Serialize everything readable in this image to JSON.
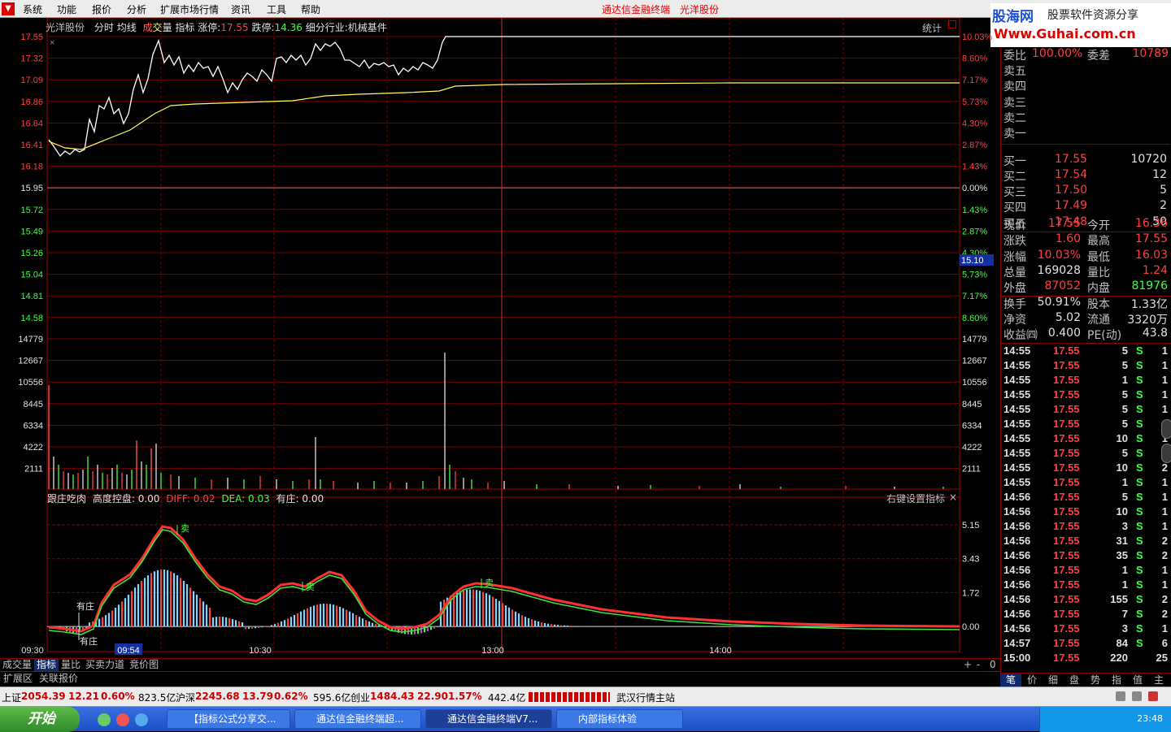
{
  "menu": {
    "items": [
      "系统",
      "功能",
      "报价",
      "分析",
      "扩展市场行情",
      "资讯",
      "工具",
      "帮助"
    ],
    "app_title": "通达信金融终端",
    "stock_title": "光洋股份"
  },
  "brand": {
    "name": "股海网",
    "tagline": "股票软件资源分享",
    "url": "Www.Guhai.com.cn"
  },
  "chart_info": {
    "stock": "光洋股份",
    "tab_fenshi": "分时",
    "tab_junxian": "均线",
    "vol_label1": "成",
    "vol_label2": "交",
    "vol_label3": "量",
    "indicator": "指标",
    "zhangting_label": "涨停:",
    "zhangting": "17.55",
    "dieting_label": "跌停:",
    "dieting": "14.36",
    "industry": "细分行业:机械基件",
    "tongji": "统计"
  },
  "price_axis": {
    "left": [
      "17.55",
      "17.32",
      "17.09",
      "16.86",
      "16.64",
      "16.41",
      "16.18",
      "15.95",
      "15.72",
      "15.49",
      "15.26",
      "15.04",
      "14.81",
      "14.58"
    ],
    "right": [
      "10.03%",
      "8.60%",
      "7.17%",
      "5.73%",
      "4.30%",
      "2.87%",
      "1.43%",
      "0.00%",
      "1.43%",
      "2.87%",
      "4.30%",
      "5.73%",
      "7.17%",
      "8.60%"
    ],
    "cursor_label": "15.10"
  },
  "volume_axis": [
    "14779",
    "12667",
    "10556",
    "8445",
    "6334",
    "4222",
    "2111"
  ],
  "sub_info": {
    "name": "跟庄吃肉",
    "kz": "高度控盘: 0.00",
    "diff": "DIFF: 0.02",
    "dea": "DEA: 0.03",
    "yz": "有庄: 0.00",
    "right_click": "右键设置指标"
  },
  "sub_axis": [
    "5.15",
    "3.43",
    "1.72",
    "0.00"
  ],
  "annotations": {
    "sell": "卖",
    "youzhuang": "有庄"
  },
  "time_axis": [
    "09:30",
    "09:54",
    "10:30",
    "13:00",
    "14:00"
  ],
  "bottom_tabs": [
    "成交量",
    "指标",
    "量比",
    "买卖力道",
    "竞价图"
  ],
  "bottom_tabs_selected": 1,
  "bottom_tabs_right": [
    "+",
    "-",
    "0"
  ],
  "row_tabs": [
    "扩展区",
    "关联报价"
  ],
  "quote": {
    "weibi_label": "委比",
    "weibi": "100.00%",
    "weicha_label": "委差",
    "weicha": "10789",
    "sell": [
      {
        "label": "卖五",
        "price": "",
        "vol": ""
      },
      {
        "label": "卖四",
        "price": "",
        "vol": ""
      },
      {
        "label": "卖三",
        "price": "",
        "vol": ""
      },
      {
        "label": "卖二",
        "price": "",
        "vol": ""
      },
      {
        "label": "卖一",
        "price": "",
        "vol": ""
      }
    ],
    "buy": [
      {
        "label": "买一",
        "price": "17.55",
        "vol": "10720"
      },
      {
        "label": "买二",
        "price": "17.54",
        "vol": "12"
      },
      {
        "label": "买三",
        "price": "17.50",
        "vol": "5"
      },
      {
        "label": "买四",
        "price": "17.49",
        "vol": "2"
      },
      {
        "label": "买五",
        "price": "17.48",
        "vol": "50"
      }
    ],
    "stats": [
      {
        "l1": "现价",
        "v1": "17.55",
        "c1": "red",
        "l2": "今开",
        "v2": "16.36",
        "c2": "red"
      },
      {
        "l1": "涨跌",
        "v1": "1.60",
        "c1": "red",
        "l2": "最高",
        "v2": "17.55",
        "c2": "red"
      },
      {
        "l1": "涨幅",
        "v1": "10.03%",
        "c1": "red",
        "l2": "最低",
        "v2": "16.03",
        "c2": "red"
      },
      {
        "l1": "总量",
        "v1": "169028",
        "c1": "wht",
        "l2": "量比",
        "v2": "1.24",
        "c2": "red"
      },
      {
        "l1": "外盘",
        "v1": "87052",
        "c1": "red",
        "l2": "内盘",
        "v2": "81976",
        "c2": "green"
      },
      {
        "l1": "换手",
        "v1": "50.91%",
        "c1": "wht",
        "l2": "股本",
        "v2": "1.33亿",
        "c2": "wht"
      },
      {
        "l1": "净资",
        "v1": "5.02",
        "c1": "wht",
        "l2": "流通",
        "v2": "3320万",
        "c2": "wht"
      },
      {
        "l1": "收益㈣",
        "v1": "0.400",
        "c1": "wht",
        "l2": "PE(动)",
        "v2": "43.8",
        "c2": "wht"
      }
    ]
  },
  "ticks": [
    {
      "t": "14:55",
      "p": "17.55",
      "v": "5",
      "s": "S",
      "n": "1"
    },
    {
      "t": "14:55",
      "p": "17.55",
      "v": "5",
      "s": "S",
      "n": "1"
    },
    {
      "t": "14:55",
      "p": "17.55",
      "v": "1",
      "s": "S",
      "n": "1"
    },
    {
      "t": "14:55",
      "p": "17.55",
      "v": "5",
      "s": "S",
      "n": "1"
    },
    {
      "t": "14:55",
      "p": "17.55",
      "v": "5",
      "s": "S",
      "n": "1"
    },
    {
      "t": "14:55",
      "p": "17.55",
      "v": "5",
      "s": "S",
      "n": "1"
    },
    {
      "t": "14:55",
      "p": "17.55",
      "v": "10",
      "s": "S",
      "n": "1"
    },
    {
      "t": "14:55",
      "p": "17.55",
      "v": "5",
      "s": "S",
      "n": "1"
    },
    {
      "t": "14:55",
      "p": "17.55",
      "v": "10",
      "s": "S",
      "n": "2"
    },
    {
      "t": "14:55",
      "p": "17.55",
      "v": "1",
      "s": "S",
      "n": "1"
    },
    {
      "t": "14:56",
      "p": "17.55",
      "v": "5",
      "s": "S",
      "n": "1"
    },
    {
      "t": "14:56",
      "p": "17.55",
      "v": "10",
      "s": "S",
      "n": "1"
    },
    {
      "t": "14:56",
      "p": "17.55",
      "v": "3",
      "s": "S",
      "n": "1"
    },
    {
      "t": "14:56",
      "p": "17.55",
      "v": "31",
      "s": "S",
      "n": "2"
    },
    {
      "t": "14:56",
      "p": "17.55",
      "v": "35",
      "s": "S",
      "n": "2"
    },
    {
      "t": "14:56",
      "p": "17.55",
      "v": "1",
      "s": "S",
      "n": "1"
    },
    {
      "t": "14:56",
      "p": "17.55",
      "v": "1",
      "s": "S",
      "n": "1"
    },
    {
      "t": "14:56",
      "p": "17.55",
      "v": "155",
      "s": "S",
      "n": "2"
    },
    {
      "t": "14:56",
      "p": "17.55",
      "v": "7",
      "s": "S",
      "n": "2"
    },
    {
      "t": "14:56",
      "p": "17.55",
      "v": "3",
      "s": "S",
      "n": "1"
    },
    {
      "t": "14:57",
      "p": "17.55",
      "v": "84",
      "s": "S",
      "n": "6"
    },
    {
      "t": "15:00",
      "p": "17.55",
      "v": "220",
      "s": "",
      "n": "25"
    }
  ],
  "right_tabs": [
    "笔",
    "价",
    "细",
    "盘",
    "势",
    "指",
    "值",
    "主"
  ],
  "status": {
    "sh_label": "上证",
    "sh": "2054.39",
    "sh_chg": "12.21",
    "sh_pct": "0.60%",
    "sh_amt": "823.5亿",
    "sz_label": "沪深",
    "sz": "2245.68",
    "sz_chg": "13.79",
    "sz_pct": "0.62%",
    "sz_amt": "595.6亿",
    "cy_label": "创业",
    "cy": "1484.43",
    "cy_chg": "22.90",
    "cy_pct": "1.57%",
    "cy_amt": "442.4亿",
    "station": "武汉行情主站"
  },
  "taskbar": {
    "start": "开始",
    "items": [
      "【指标公式分享交...",
      "通达信金融终端超...",
      "通达信金融终端V7...",
      "内部指标体验"
    ],
    "clock": "23:48"
  }
}
